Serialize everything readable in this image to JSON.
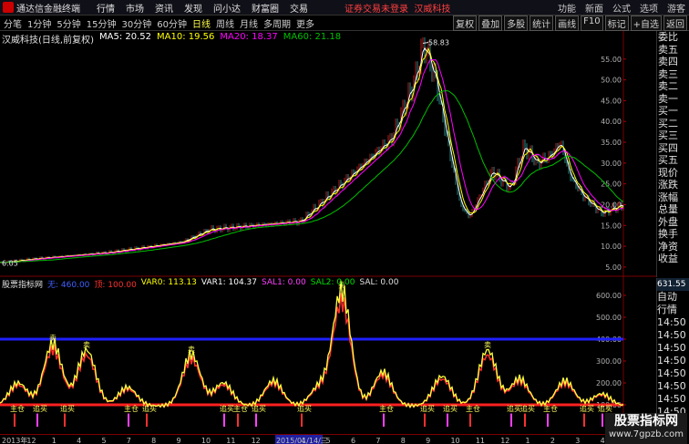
{
  "titlebar": {
    "app_title": "通达信金融终端",
    "menu": [
      "行情",
      "市场",
      "资讯",
      "发现",
      "问小达",
      "财富圈",
      "交易"
    ],
    "notice": "证券交易未登录",
    "stock_name": "汉威科技",
    "right": [
      "功能",
      "新面",
      "公式",
      "选项",
      "游客"
    ]
  },
  "toolbar": {
    "periods": [
      "分笔",
      "1分钟",
      "5分钟",
      "15分钟",
      "30分钟",
      "60分钟",
      "日线",
      "周线",
      "月线",
      "多周期",
      "更多"
    ],
    "active": "日线",
    "tools": [
      "复权",
      "叠加",
      "多股",
      "统计",
      "画线",
      "F10",
      "标记",
      "+自选",
      "返回"
    ]
  },
  "main_legend": {
    "title": "汉威科技(日线,前复权)",
    "ma5": "MA5: 20.52",
    "ma10": "MA10: 19.56",
    "ma20": "MA20: 18.37",
    "ma60": "MA60: 21.18",
    "high_label": "58.83",
    "low_label": "6.05"
  },
  "sub_legend": {
    "name": "股票指标网",
    "v1": "无: 460.00",
    "v2": "顶: 100.00",
    "v3": "VAR0: 113.13",
    "v4": "VAR1: 104.37",
    "v5": "SAL1: 0.00",
    "v6": "SAL2: 0.00",
    "v7": "SAL: 0.00",
    "tag1": "主仓",
    "tag2": "追买",
    "tag3": "卖"
  },
  "price_axis": [
    "55.00",
    "50.00",
    "45.00",
    "40.00",
    "35.00",
    "30.00",
    "25.00",
    "20.00",
    "15.00",
    "10.00",
    "5.00"
  ],
  "sub_axis": [
    "600.00",
    "500.00",
    "400.00",
    "300.00",
    "200.00",
    "100.00"
  ],
  "side_panel": [
    "委比",
    "卖五",
    "卖四",
    "卖三",
    "卖二",
    "卖一",
    "买一",
    "买二",
    "买三",
    "买四",
    "买五",
    "现价",
    "涨跌",
    "涨幅",
    "总量",
    "外盘",
    "换手",
    "净资",
    "收益"
  ],
  "side_panel2": {
    "price": "631.55",
    "items": [
      "自动",
      "行情",
      "14:50",
      "14:50",
      "14:50",
      "14:50",
      "14:50",
      "14:50",
      "14:50",
      "14:50"
    ]
  },
  "date_axis": [
    "2013年",
    "12",
    "1",
    "4",
    "5",
    "7",
    "8",
    "9",
    "10",
    "11",
    "12",
    "2015/01/14/三",
    "4",
    "5",
    "6",
    "7",
    "8",
    "9",
    "10",
    "11",
    "12",
    "1",
    "2",
    "3",
    "4"
  ],
  "watermark": {
    "big": "股票指标网",
    "small": "www.7gpzb.com"
  },
  "chart_data": {
    "type": "line",
    "series": [
      {
        "name": "MA5",
        "color": "#ffffff"
      },
      {
        "name": "MA10",
        "color": "#ffff00"
      },
      {
        "name": "MA20",
        "color": "#ff00ff"
      },
      {
        "name": "MA60",
        "color": "#00c000"
      }
    ],
    "price_range": [
      3,
      60
    ],
    "peak": 58.83,
    "low": 6.05
  }
}
